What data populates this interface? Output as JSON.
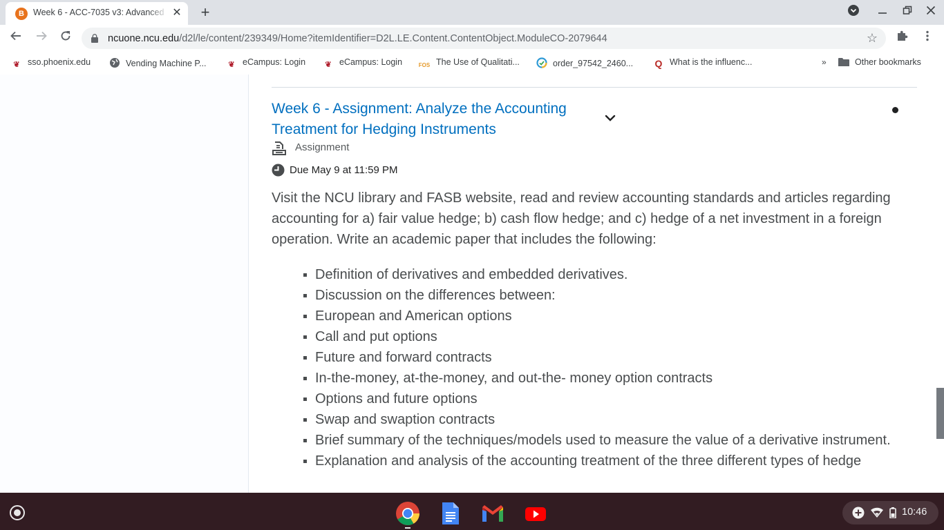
{
  "browser": {
    "tab_title": "Week 6 - ACC-7035 v3: Advanced",
    "tab_favicon_letter": "B",
    "url_host": "ncuone.ncu.edu",
    "url_path": "/d2l/le/content/239349/Home?itemIdentifier=D2L.LE.Content.ContentObject.ModuleCO-2079644"
  },
  "bookmarks": [
    {
      "label": "sso.phoenix.edu",
      "icon": "phoenix-icon"
    },
    {
      "label": "Vending Machine P...",
      "icon": "globe-icon"
    },
    {
      "label": "eCampus: Login",
      "icon": "phoenix-icon"
    },
    {
      "label": "eCampus: Login",
      "icon": "phoenix-icon"
    },
    {
      "label": "The Use of Qualitati...",
      "icon": "fos-icon",
      "icon_text": "FOS"
    },
    {
      "label": "order_97542_2460...",
      "icon": "circle-check-icon"
    },
    {
      "label": "What is the influenc...",
      "icon": "quora-icon",
      "icon_text": "Q"
    }
  ],
  "bookmarks_overflow": "»",
  "other_bookmarks": "Other bookmarks",
  "content": {
    "title": "Week 6 - Assignment: Analyze the Accounting Treatment for Hedging Instruments",
    "type_label": "Assignment",
    "due": "Due May 9 at 11:59 PM",
    "description": "Visit the NCU library and FASB website, read and review accounting standards and articles regarding accounting for a) fair value hedge; b) cash flow hedge; and c) hedge of a net investment in a foreign operation. Write an academic paper that includes the following:",
    "items": [
      "Definition of derivatives and embedded derivatives.",
      "Discussion on the differences between:",
      "European and American options",
      "Call and put options",
      "Future and forward contracts",
      "In-the-money, at-the-money, and out-the- money option contracts",
      "Options and future options",
      "Swap and swaption contracts",
      "Brief summary of the techniques/models used to measure the value of a derivative instrument.",
      "Explanation and analysis of the accounting treatment of the three different types of hedge"
    ]
  },
  "taskbar": {
    "time": "10:46"
  },
  "colors": {
    "title_link": "#006fbf",
    "body_text": "#494c4e",
    "taskbar": "#321c22"
  }
}
